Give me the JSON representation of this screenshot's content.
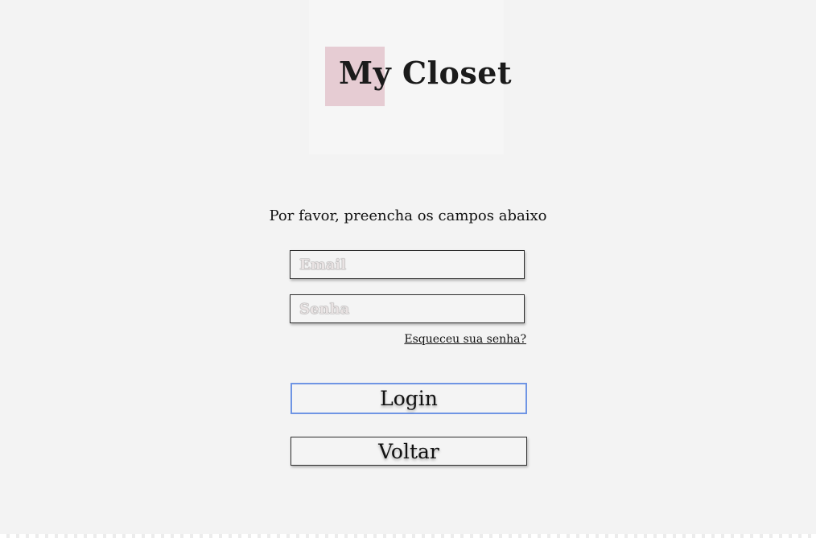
{
  "logo": {
    "text": "My Closet"
  },
  "form": {
    "instructions": "Por favor, preencha os campos abaixo",
    "email_placeholder": "Email",
    "email_value": "",
    "password_placeholder": "Senha",
    "password_value": "",
    "forgot_password_link": "Esqueceu sua senha?"
  },
  "actions": {
    "login_label": "Login",
    "back_label": "Voltar"
  },
  "colors": {
    "background": "#f3f3f3",
    "logo_accent": "#e6ccd3",
    "focus_border": "#6f95e4"
  }
}
